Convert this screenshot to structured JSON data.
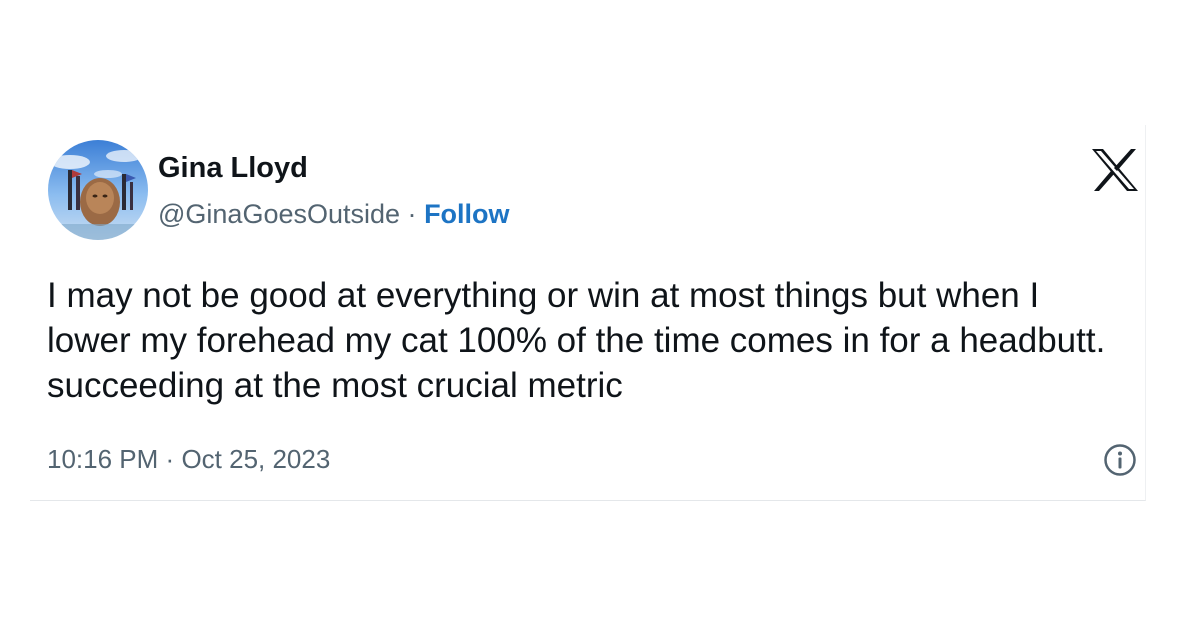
{
  "tweet": {
    "author": {
      "name": "Gina Lloyd",
      "handle": "@GinaGoesOutside",
      "separator": "·",
      "follow_label": "Follow"
    },
    "text": "I may not be good at everything or win at most things but when I lower my forehead my cat 100% of the time comes in for a headbutt. succeeding at the most crucial metric",
    "time": "10:16 PM",
    "date_separator": "·",
    "date": "Oct 25, 2023"
  },
  "icons": {
    "brand": "x-logo-icon",
    "info": "info-icon",
    "avatar": "avatar"
  },
  "colors": {
    "text": "#0f1419",
    "secondary": "#536471",
    "link": "#1d74c4",
    "background": "#ffffff"
  }
}
